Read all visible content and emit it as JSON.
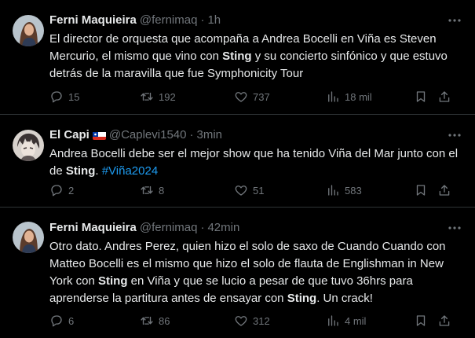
{
  "tweets": [
    {
      "name": "Ferni Maquieira",
      "handle": "@fernimaq",
      "time": "1h",
      "text_segments": [
        {
          "t": "El director de orquesta que acompaña a Andrea Bocelli en Viña es Steven Mercurio, el mismo que vino con "
        },
        {
          "t": "Sting",
          "bold": true
        },
        {
          "t": " y su concierto sinfónico y que estuvo detrás de la maravilla que fue Symphonicity Tour"
        }
      ],
      "replies": "15",
      "retweets": "192",
      "likes": "737",
      "views": "18 mil"
    },
    {
      "name": "El Capi",
      "flag": "chile-flag",
      "handle": "@Caplevi1540",
      "time": "3min",
      "text_segments": [
        {
          "t": "Andrea Bocelli debe ser el mejor show que ha tenido Viña del Mar junto con el de "
        },
        {
          "t": "Sting",
          "bold": true
        },
        {
          "t": ". "
        },
        {
          "t": "#Viña2024",
          "hashtag": true
        }
      ],
      "replies": "2",
      "retweets": "8",
      "likes": "51",
      "views": "583"
    },
    {
      "name": "Ferni Maquieira",
      "handle": "@fernimaq",
      "time": "42min",
      "text_segments": [
        {
          "t": "Otro dato. Andres Perez, quien hizo el solo de saxo de Cuando Cuando con Matteo Bocelli es el mismo que hizo el solo de flauta de Englishman in New York con "
        },
        {
          "t": "Sting",
          "bold": true
        },
        {
          "t": " en Viña y que se lucio a pesar de que tuvo 36hrs para aprenderse la partitura antes de ensayar con "
        },
        {
          "t": "Sting",
          "bold": true
        },
        {
          "t": ". Un crack!"
        }
      ],
      "replies": "6",
      "retweets": "86",
      "likes": "312",
      "views": "4 mil"
    }
  ],
  "colors": {
    "background": "#000000",
    "text": "#e7e9ea",
    "secondary": "#71767b",
    "accent": "#1d9bf0",
    "divider": "#2f3336"
  }
}
